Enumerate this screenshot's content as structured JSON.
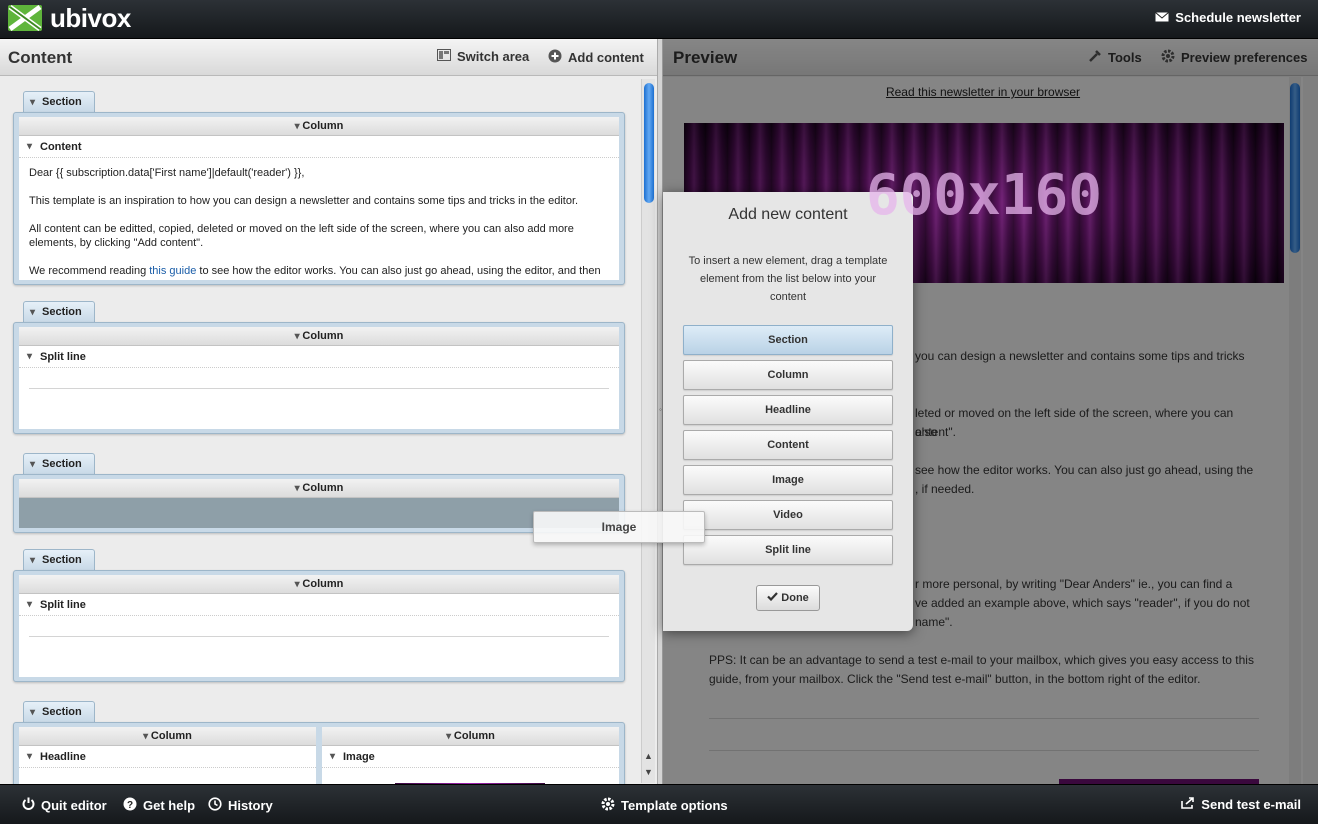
{
  "app": {
    "name": "ubivox"
  },
  "topbar": {
    "schedule_label": "Schedule newsletter"
  },
  "content_panel": {
    "title": "Content",
    "switch_area_label": "Switch area",
    "add_content_label": "Add content"
  },
  "sections": [
    {
      "tab": "Section",
      "column": "Column",
      "element": "Content",
      "paragraphs": [
        "Dear {{ subscription.data['First name']|default('reader') }},",
        "This template is an inspiration to how you can design a newsletter and contains some tips and tricks in the editor.",
        "All content can be editted, copied, deleted or moved on the left side of the screen, where you can also add more elements, by clicking \"Add content\"."
      ],
      "p4_before": "We recommend reading ",
      "p4_link": "this guide",
      "p4_after": " to see how the editor works. You can also just go ahead, using the editor, and then"
    },
    {
      "tab": "Section",
      "column": "Column",
      "element": "Split line"
    },
    {
      "tab": "Section",
      "column": "Column"
    },
    {
      "tab": "Section",
      "column": "Column",
      "element": "Split line"
    },
    {
      "tab": "Section",
      "col1": "Column",
      "col1_element": "Headline",
      "col2": "Column",
      "col2_element": "Image"
    }
  ],
  "preview_panel": {
    "title": "Preview",
    "tools_label": "Tools",
    "prefs_label": "Preview preferences",
    "read_link": "Read this newsletter in your browser",
    "banner_text": "600x160",
    "lines": [
      "you can design a newsletter and contains some tips and tricks",
      "leted or moved on the left side of the screen, where you can also",
      "ontent\".",
      "see how the editor works. You can also just go ahead, using the",
      ", if needed.",
      "r more personal, by writing \"Dear Anders\" ie., you can find a",
      "ve added an example above, which says \"reader\", if you do not",
      "name\".",
      "PPS: It can be an advantage to send a test e-mail to your mailbox, which gives you easy access to this",
      "guide, from your mailbox. Click the \"Send test e-mail\" button, in the bottom right of the editor."
    ]
  },
  "modal": {
    "title": "Add new content",
    "description": "To insert a new element, drag a template element from the list below into your content",
    "templates": [
      "Section",
      "Column",
      "Headline",
      "Content",
      "Image",
      "Video",
      "Split line"
    ],
    "done_label": "Done"
  },
  "drag_ghost": {
    "label": "Image"
  },
  "bottombar": {
    "quit_label": "Quit editor",
    "help_label": "Get help",
    "history_label": "History",
    "template_options_label": "Template options",
    "send_test_label": "Send test e-mail"
  },
  "colors": {
    "brand": "#5fb53b",
    "accent": "#1c6fd0",
    "link": "#1a5da8"
  }
}
